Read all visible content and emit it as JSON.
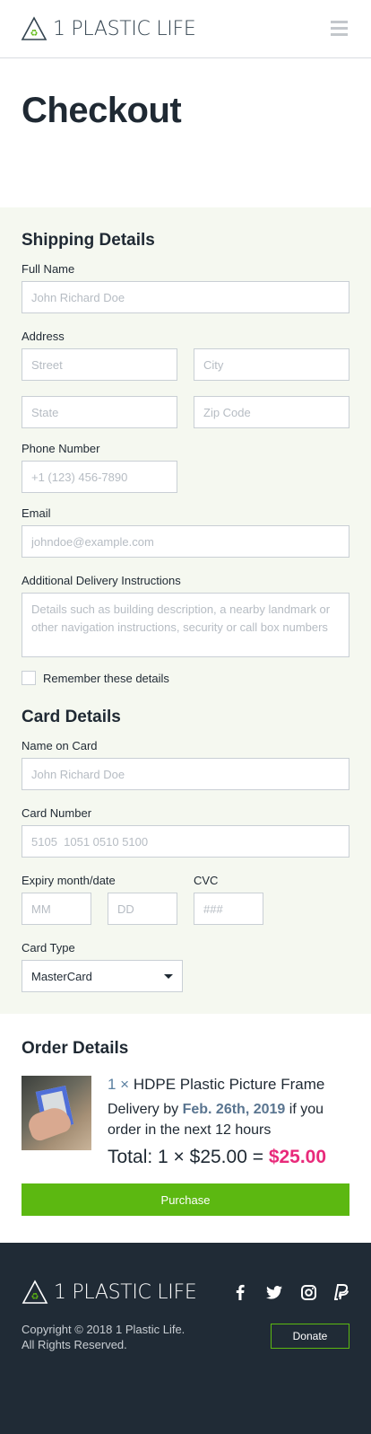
{
  "brand": {
    "name": "1 PLASTIC LIFE"
  },
  "page": {
    "title": "Checkout"
  },
  "shipping": {
    "heading": "Shipping Details",
    "full_name_label": "Full Name",
    "full_name_placeholder": "John Richard Doe",
    "address_label": "Address",
    "street_placeholder": "Street",
    "city_placeholder": "City",
    "state_placeholder": "State",
    "zip_placeholder": "Zip Code",
    "phone_label": "Phone Number",
    "phone_placeholder": "+1 (123) 456-7890",
    "email_label": "Email",
    "email_placeholder": "johndoe@example.com",
    "instructions_label": "Additional Delivery Instructions",
    "instructions_placeholder": "Details such as building description, a nearby landmark or other navigation instructions, security or call box numbers",
    "remember_label": "Remember these details"
  },
  "card": {
    "heading": "Card Details",
    "name_label": "Name on Card",
    "name_placeholder": "John Richard Doe",
    "number_label": "Card Number",
    "number_placeholder": "5105  1051 0510 5100",
    "expiry_label": "Expiry month/date",
    "mm_placeholder": "MM",
    "dd_placeholder": "DD",
    "cvc_label": "CVC",
    "cvc_placeholder": "###",
    "type_label": "Card Type",
    "type_value": "MasterCard"
  },
  "order": {
    "heading": "Order Details",
    "quantity": "1 ×",
    "item_name": "HDPE Plastic Picture Frame",
    "delivery_prefix": "Delivery by",
    "delivery_date": "Feb. 26th, 2019",
    "delivery_suffix": "if you order in the next 12 hours",
    "total_prefix": "Total: 1 × $25.00 =",
    "total_amount": "$25.00",
    "purchase_label": "Purchase"
  },
  "footer": {
    "copyright_line1": "Copyright © 2018 1 Plastic Life.",
    "copyright_line2": "All Rights Reserved.",
    "donate_label": "Donate",
    "social_icons": [
      "facebook-icon",
      "twitter-icon",
      "instagram-icon",
      "paypal-icon"
    ]
  },
  "colors": {
    "accent_green": "#5cb811",
    "price_pink": "#e82a7a",
    "footer_bg": "#202b36",
    "form_bg": "#f5f8f0"
  }
}
